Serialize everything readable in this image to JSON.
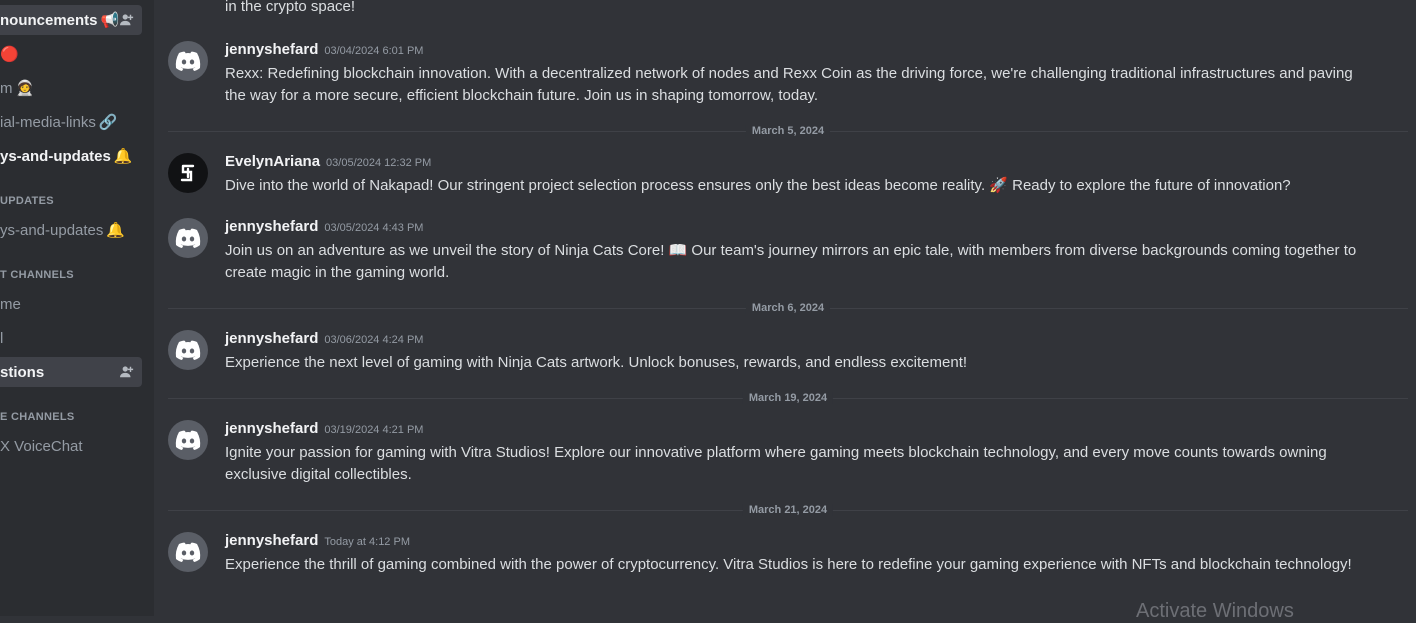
{
  "sidebar": {
    "channels": [
      {
        "label": "nouncements",
        "emoji": "📢",
        "add_member": true,
        "state": "unread-selected"
      },
      {
        "label": "",
        "emoji": "🔴",
        "add_member": false,
        "state": "normal"
      },
      {
        "label": "m",
        "emoji": "🧑‍🚀",
        "add_member": false,
        "state": "normal"
      },
      {
        "label": "ial-media-links",
        "emoji": "🔗",
        "add_member": false,
        "state": "normal"
      },
      {
        "label": "ys-and-updates",
        "emoji": "🔔",
        "add_member": false,
        "state": "unread"
      }
    ],
    "category_updates": "UPDATES",
    "updates_channel": {
      "label": "ys-and-updates",
      "emoji": "🔔"
    },
    "category_text": "T CHANNELS",
    "text_channels": [
      {
        "label": "me"
      },
      {
        "label": "l"
      },
      {
        "label": "stions",
        "selected": true
      }
    ],
    "category_voice": "E CHANNELS",
    "voice_channel": {
      "label": "X VoiceChat"
    }
  },
  "messages": {
    "partial_top": "in the crypto space!",
    "m1": {
      "author": "jennyshefard",
      "time": "03/04/2024 6:01 PM",
      "text": "Rexx: Redefining blockchain innovation. With a decentralized network of nodes and Rexx Coin as the driving force, we're challenging traditional infrastructures and paving the way for a more secure, efficient blockchain future. Join us in shaping tomorrow, today."
    },
    "d1": "March 5, 2024",
    "m2": {
      "author": "EvelynAriana",
      "time": "03/05/2024 12:32 PM",
      "text": "Dive into the world of Nakapad! Our stringent project selection process ensures only the best ideas become reality. 🚀 Ready to explore the future of innovation?"
    },
    "m3": {
      "author": "jennyshefard",
      "time": "03/05/2024 4:43 PM",
      "text": "Join us on an adventure as we unveil the story of Ninja Cats Core! 📖 Our team's journey mirrors an epic tale, with members from diverse backgrounds coming together to create magic in the gaming world."
    },
    "d2": "March 6, 2024",
    "m4": {
      "author": "jennyshefard",
      "time": "03/06/2024 4:24 PM",
      "text": "Experience the next level of gaming with Ninja Cats artwork. Unlock bonuses, rewards, and endless excitement!"
    },
    "d3": "March 19, 2024",
    "m5": {
      "author": "jennyshefard",
      "time": "03/19/2024 4:21 PM",
      "text": "Ignite your passion for gaming with Vitra Studios! Explore our innovative platform where gaming meets blockchain technology, and every move counts towards owning exclusive digital collectibles."
    },
    "d4": "March 21, 2024",
    "m6": {
      "author": "jennyshefard",
      "time": "Today at 4:12 PM",
      "text": "Experience the thrill of gaming combined with the power of cryptocurrency. Vitra Studios is here to redefine your gaming experience with NFTs and blockchain technology!"
    }
  },
  "watermark": "Activate Windows",
  "colors": {
    "background": "#313338",
    "sidebar": "#2b2d31",
    "selected": "#404249",
    "discord_avatar": "#5a5e66"
  }
}
